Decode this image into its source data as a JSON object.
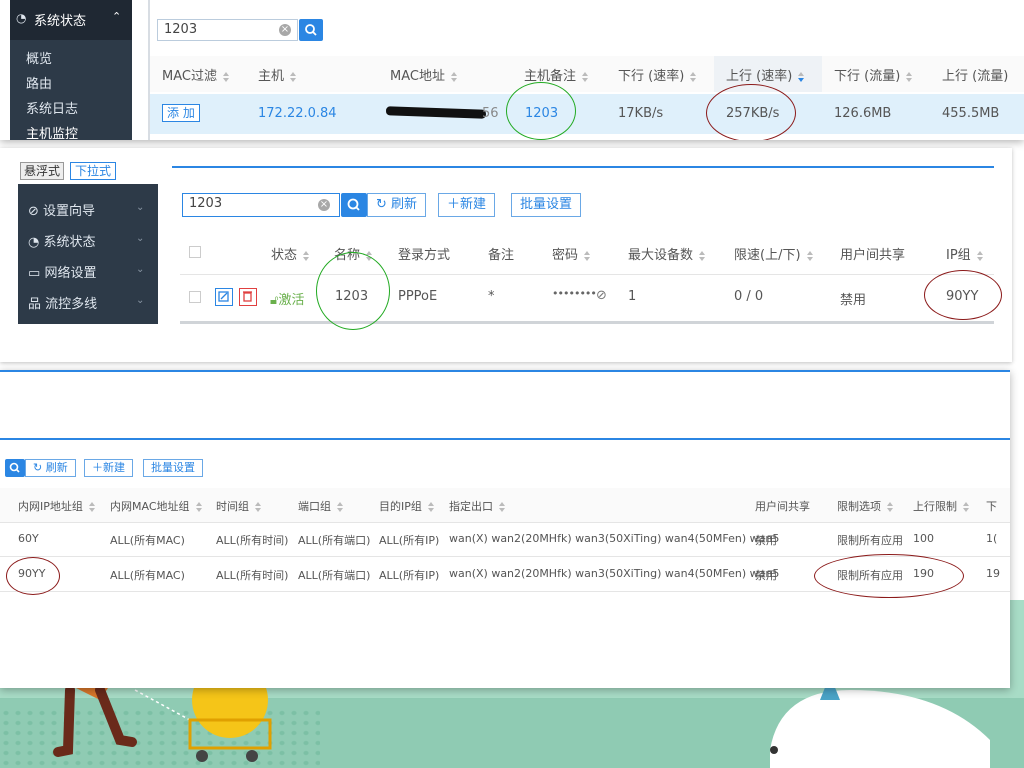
{
  "shot1": {
    "sidebar": {
      "header": "系统状态",
      "items": [
        "概览",
        "路由",
        "系统日志",
        "主机监控"
      ]
    },
    "search_value": "1203",
    "columns": [
      "MAC过滤",
      "主机",
      "MAC地址",
      "主机备注",
      "下行 (速率)",
      "上行 (速率)",
      "下行 (流量)",
      "上行 (流量)"
    ],
    "row": {
      "add": "添 加",
      "host": "172.22.0.84",
      "mac_tail": "56",
      "note": "1203",
      "down_rate": "17KB/s",
      "up_rate": "257KB/s",
      "down_flow": "126.6MB",
      "up_flow": "455.5MB"
    }
  },
  "shot2": {
    "tabs": [
      "悬浮式",
      "下拉式"
    ],
    "sidebar": [
      "设置向导",
      "系统状态",
      "网络设置",
      "流控多线"
    ],
    "search_value": "1203",
    "buttons": {
      "refresh": "刷新",
      "new": "新建",
      "batch": "批量设置"
    },
    "columns": [
      "状态",
      "名称",
      "登录方式",
      "备注",
      "密码",
      "最大设备数",
      "限速(上/下)",
      "用户间共享",
      "IP组"
    ],
    "row": {
      "status": "激活",
      "name": "1203",
      "login": "PPPoE",
      "note": "*",
      "password": "••••••••",
      "max_devices": "1",
      "speed": "0 / 0",
      "share": "禁用",
      "ipgroup": "90YY"
    }
  },
  "shot3": {
    "buttons": {
      "refresh": "刷新",
      "new": "新建",
      "batch": "批量设置"
    },
    "columns": [
      "内网IP地址组",
      "内网MAC地址组",
      "时间组",
      "端口组",
      "目的IP组",
      "指定出口",
      "用户间共享",
      "限制选项",
      "上行限制",
      "下"
    ],
    "rows": [
      [
        "60Y",
        "ALL(所有MAC)",
        "ALL(所有时间)",
        "ALL(所有端口)",
        "ALL(所有IP)",
        "wan(X) wan2(20MHfk) wan3(50XiTing) wan4(50MFen) wan5",
        "禁用",
        "限制所有应用",
        "100",
        "1("
      ],
      [
        "90YY",
        "ALL(所有MAC)",
        "ALL(所有时间)",
        "ALL(所有端口)",
        "ALL(所有IP)",
        "wan(X) wan2(20MHfk) wan3(50XiTing) wan4(50MFen) wan5",
        "禁用",
        "限制所有应用",
        "190",
        "19"
      ]
    ]
  },
  "colors": {
    "accent": "#2b86e3",
    "annot_red": "#8b1a1a",
    "annot_green": "#22aa22",
    "sidebar": "#2d3a48"
  }
}
